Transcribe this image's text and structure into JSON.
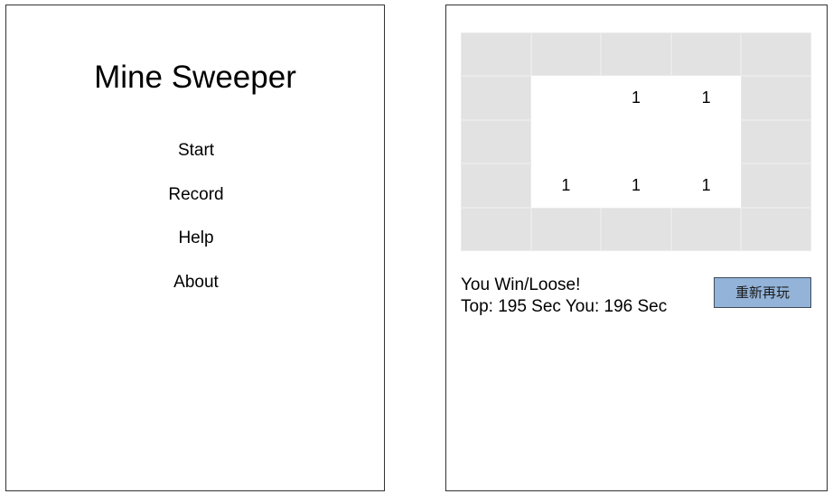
{
  "menu": {
    "title": "Mine Sweeper",
    "items": [
      {
        "label": "Start"
      },
      {
        "label": "Record"
      },
      {
        "label": "Help"
      },
      {
        "label": "About"
      }
    ]
  },
  "game": {
    "board": [
      [
        "",
        "",
        "",
        "",
        ""
      ],
      [
        "",
        "",
        "1",
        "1",
        ""
      ],
      [
        "",
        "",
        "",
        "",
        ""
      ],
      [
        "",
        "1",
        "1",
        "1",
        ""
      ],
      [
        "",
        "",
        "",
        "",
        ""
      ]
    ],
    "covered": [
      [
        true,
        true,
        true,
        true,
        true
      ],
      [
        true,
        false,
        false,
        false,
        true
      ],
      [
        true,
        false,
        false,
        false,
        true
      ],
      [
        true,
        false,
        false,
        false,
        true
      ],
      [
        true,
        true,
        true,
        true,
        true
      ]
    ],
    "status": {
      "result": "You Win/Loose!",
      "top_label": "Top:",
      "top_value": "195 Sec",
      "you_label": "You:",
      "you_value": "196 Sec"
    },
    "replay_label": "重新再玩"
  },
  "colors": {
    "covered_cell": "#e2e2e2",
    "open_cell": "#ffffff",
    "replay_button": "#93b3d8"
  }
}
